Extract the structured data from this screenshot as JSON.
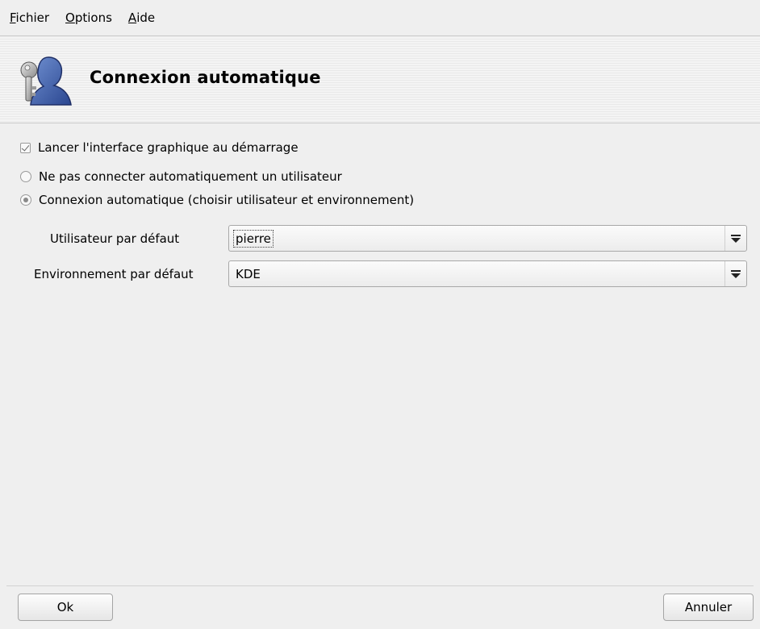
{
  "menu": {
    "items": [
      {
        "underline": "F",
        "rest": "ichier"
      },
      {
        "underline": "O",
        "rest": "ptions"
      },
      {
        "underline": "A",
        "rest": "ide"
      }
    ]
  },
  "header": {
    "title": "Connexion automatique",
    "icon": "user-key-icon"
  },
  "options": {
    "launch_gui": {
      "label": "Lancer l'interface graphique au démarrage",
      "checked": true
    },
    "no_autologin": {
      "label": "Ne pas connecter automatiquement un utilisateur",
      "selected": false
    },
    "autologin": {
      "label": "Connexion automatique (choisir utilisateur et environnement)",
      "selected": true
    }
  },
  "fields": {
    "user": {
      "label": "Utilisateur par défaut",
      "value": "pierre"
    },
    "environment": {
      "label": "Environnement par défaut",
      "value": "KDE"
    }
  },
  "buttons": {
    "ok": "Ok",
    "cancel": "Annuler"
  },
  "colors": {
    "background": "#efefef",
    "icon_blue": "#3b5da6"
  }
}
